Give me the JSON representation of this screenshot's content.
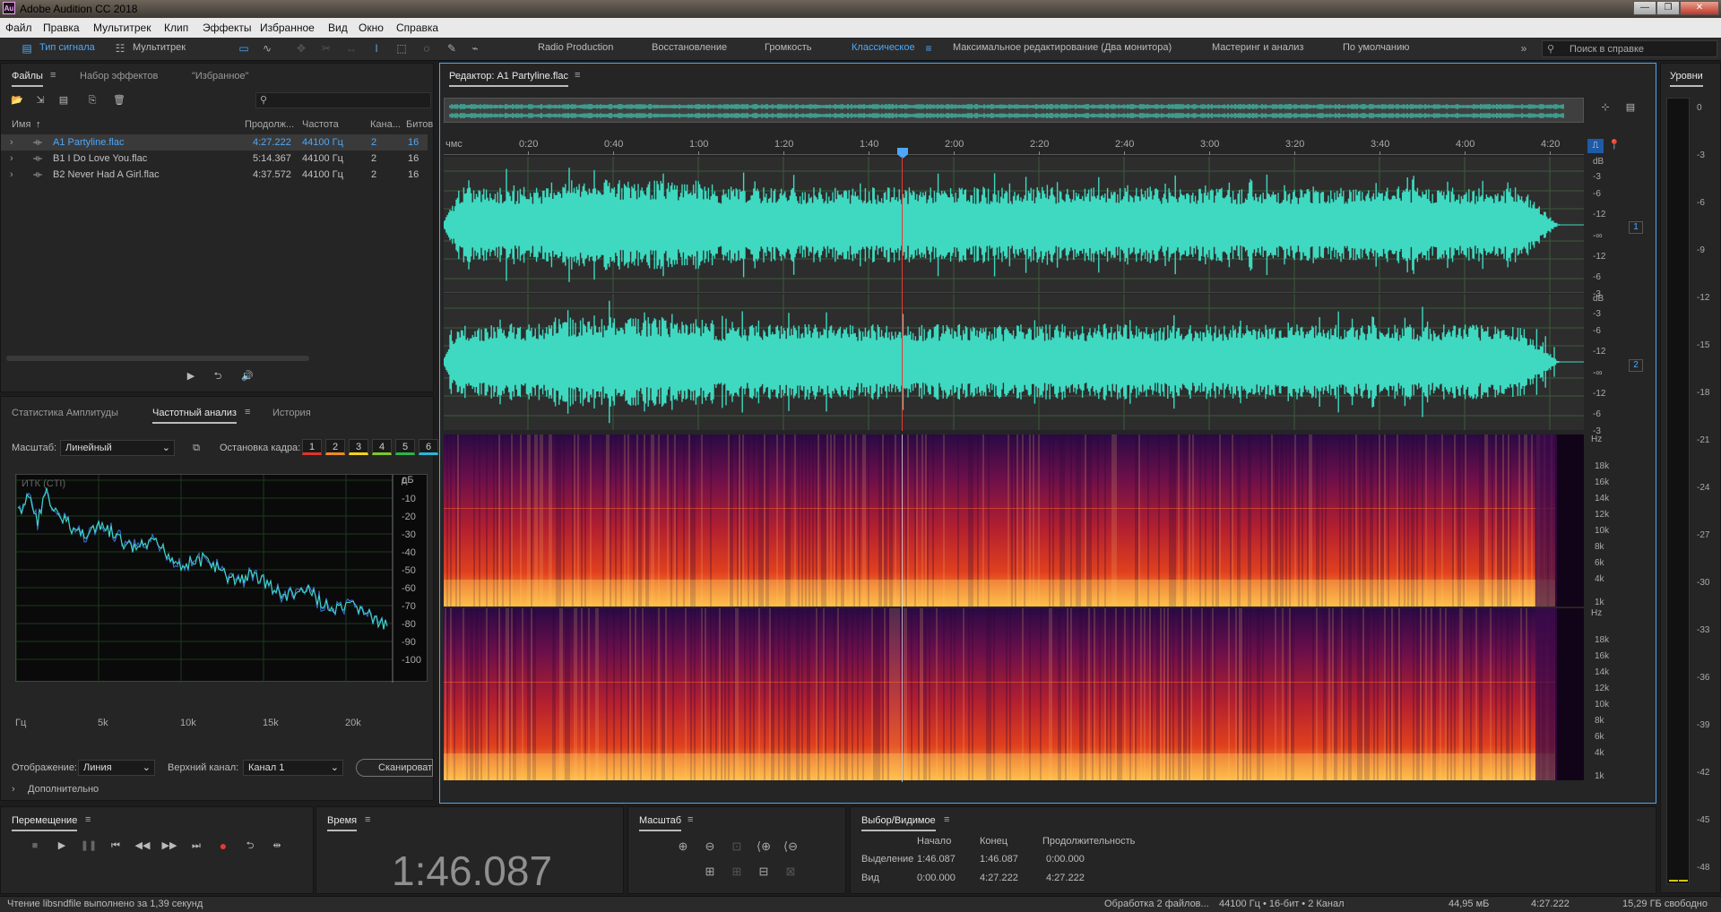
{
  "window": {
    "app_icon": "Au",
    "title": "Adobe Audition CC 2018"
  },
  "menu": [
    "Файл",
    "Правка",
    "Мультитрек",
    "Клип",
    "Эффекты",
    "Избранное",
    "Вид",
    "Окно",
    "Справка"
  ],
  "toolbar": {
    "signal_type": "Тип сигнала",
    "multitrack": "Мультитрек",
    "workspaces": [
      "Radio Production",
      "Восстановление",
      "Громкость",
      "Классическое",
      "Максимальное редактирование (Два монитора)",
      "Мастеринг и анализ",
      "По умолчанию"
    ],
    "active_workspace": "Классическое",
    "search_placeholder": "Поиск в справке"
  },
  "files_panel": {
    "tabs": [
      "Файлы",
      "Набор эффектов",
      "\"Избранное\""
    ],
    "columns": [
      "Имя",
      "Продолж...",
      "Частота",
      "Кана...",
      "Битов"
    ],
    "rows": [
      {
        "name": "A1 Partyline.flac",
        "duration": "4:27.222",
        "rate": "44100 Гц",
        "channels": "2",
        "bits": "16"
      },
      {
        "name": "B1 I Do Love You.flac",
        "duration": "5:14.367",
        "rate": "44100 Гц",
        "channels": "2",
        "bits": "16"
      },
      {
        "name": "B2 Never Had A Girl.flac",
        "duration": "4:37.572",
        "rate": "44100 Гц",
        "channels": "2",
        "bits": "16"
      }
    ]
  },
  "analysis_panel": {
    "tabs": [
      "Статистика Амплитуды",
      "Частотный анализ",
      "История"
    ],
    "scale_label": "Масштаб:",
    "scale_value": "Линейный",
    "freeze_label": "Остановка кадра:",
    "freeze_buttons": [
      "1",
      "2",
      "3",
      "4",
      "5",
      "6"
    ],
    "freeze_colors": [
      "#e0342d",
      "#f08a24",
      "#f5d21e",
      "#7ec72b",
      "#2bb64a",
      "#2bb7d9"
    ],
    "graph_label": "ИТК (CTI)",
    "db_unit": "дБ",
    "db_ticks": [
      "0",
      "-10",
      "-20",
      "-30",
      "-40",
      "-50",
      "-60",
      "-70",
      "-80",
      "-90",
      "-100"
    ],
    "hz_ticks": [
      "Гц",
      "5k",
      "10k",
      "15k",
      "20k"
    ],
    "display_label": "Отображение:",
    "display_value": "Линия",
    "top_channel_label": "Верхний канал:",
    "top_channel_value": "Канал 1",
    "scan_button": "Сканировать",
    "advanced": "Дополнительно"
  },
  "editor": {
    "title": "Редактор: A1 Partyline.flac",
    "ruler_unit": "чмс",
    "ruler": [
      "0:20",
      "0:40",
      "1:00",
      "1:20",
      "1:40",
      "2:00",
      "2:20",
      "2:40",
      "3:00",
      "3:20",
      "3:40",
      "4:00",
      "4:20"
    ],
    "db_scale": [
      "dB",
      "-3",
      "-6",
      "-12",
      "-∞",
      "-12",
      "-6",
      "-3"
    ],
    "channels": [
      "1",
      "2"
    ],
    "hz_scale": [
      "Hz",
      "18k",
      "16k",
      "14k",
      "12k",
      "10k",
      "8k",
      "6k",
      "4k",
      "1k"
    ],
    "waveform_color": "#3ed9c0",
    "playhead_color": "#e53935"
  },
  "meter": {
    "title": "Уровни",
    "ticks": [
      "0",
      "-3",
      "-6",
      "-9",
      "-12",
      "-15",
      "-18",
      "-21",
      "-24",
      "-27",
      "-30",
      "-33",
      "-36",
      "-39",
      "-42",
      "-45",
      "-48"
    ]
  },
  "transport": {
    "title": "Перемещение"
  },
  "time_panel": {
    "title": "Время",
    "value": "1:46.087"
  },
  "zoom_panel": {
    "title": "Масштаб"
  },
  "selection_panel": {
    "title": "Выбор/Видимое",
    "col_start": "Начало",
    "col_end": "Конец",
    "col_duration": "Продолжительность",
    "selection_label": "Выделение",
    "selection": [
      "1:46.087",
      "1:46.087",
      "0:00.000"
    ],
    "view_label": "Вид",
    "view": [
      "0:00.000",
      "4:27.222",
      "4:27.222"
    ]
  },
  "status": {
    "left": "Чтение libsndfile выполнено за 1,39 секунд",
    "processing": "Обработка 2 файлов...",
    "format": "44100 Гц • 16-бит • 2 Канал",
    "size": "44,95 мБ",
    "duration": "4:27.222",
    "free": "15,29 ГБ свободно"
  }
}
